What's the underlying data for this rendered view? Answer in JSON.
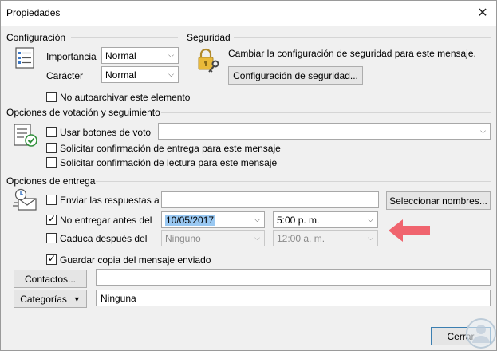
{
  "window": {
    "title": "Propiedades"
  },
  "config": {
    "heading": "Configuración",
    "importance_label": "Importancia",
    "importance_value": "Normal",
    "sensitivity_label": "Carácter",
    "sensitivity_value": "Normal",
    "no_autoarchive": {
      "label": "No autoarchivar este elemento",
      "checked": false
    }
  },
  "security": {
    "heading": "Seguridad",
    "description": "Cambiar la configuración de seguridad para este mensaje.",
    "button": "Configuración de seguridad..."
  },
  "voting": {
    "heading": "Opciones de votación y seguimiento",
    "use_voting": {
      "label": "Usar botones de voto",
      "checked": false
    },
    "voting_value": "",
    "delivery_receipt": {
      "label": "Solicitar confirmación de entrega para este mensaje",
      "checked": false
    },
    "read_receipt": {
      "label": "Solicitar confirmación de lectura para este mensaje",
      "checked": false
    }
  },
  "delivery": {
    "heading": "Opciones de entrega",
    "send_replies": {
      "label": "Enviar las respuestas a",
      "checked": false,
      "value": ""
    },
    "select_names_button": "Seleccionar nombres...",
    "do_not_deliver": {
      "label": "No entregar antes del",
      "checked": true,
      "date": "10/05/2017",
      "time": "5:00 p. m."
    },
    "expires": {
      "label": "Caduca después del",
      "checked": false,
      "date": "Ninguno",
      "time": "12:00 a. m."
    },
    "save_copy": {
      "label": "Guardar copia del mensaje enviado",
      "checked": true
    }
  },
  "contacts": {
    "button": "Contactos...",
    "value": ""
  },
  "categories": {
    "button": "Categorías",
    "value": "Ninguna"
  },
  "footer": {
    "close_button": "Cerrar"
  },
  "colors": {
    "arrow": "#f0646e",
    "selection": "#99c8f2"
  }
}
